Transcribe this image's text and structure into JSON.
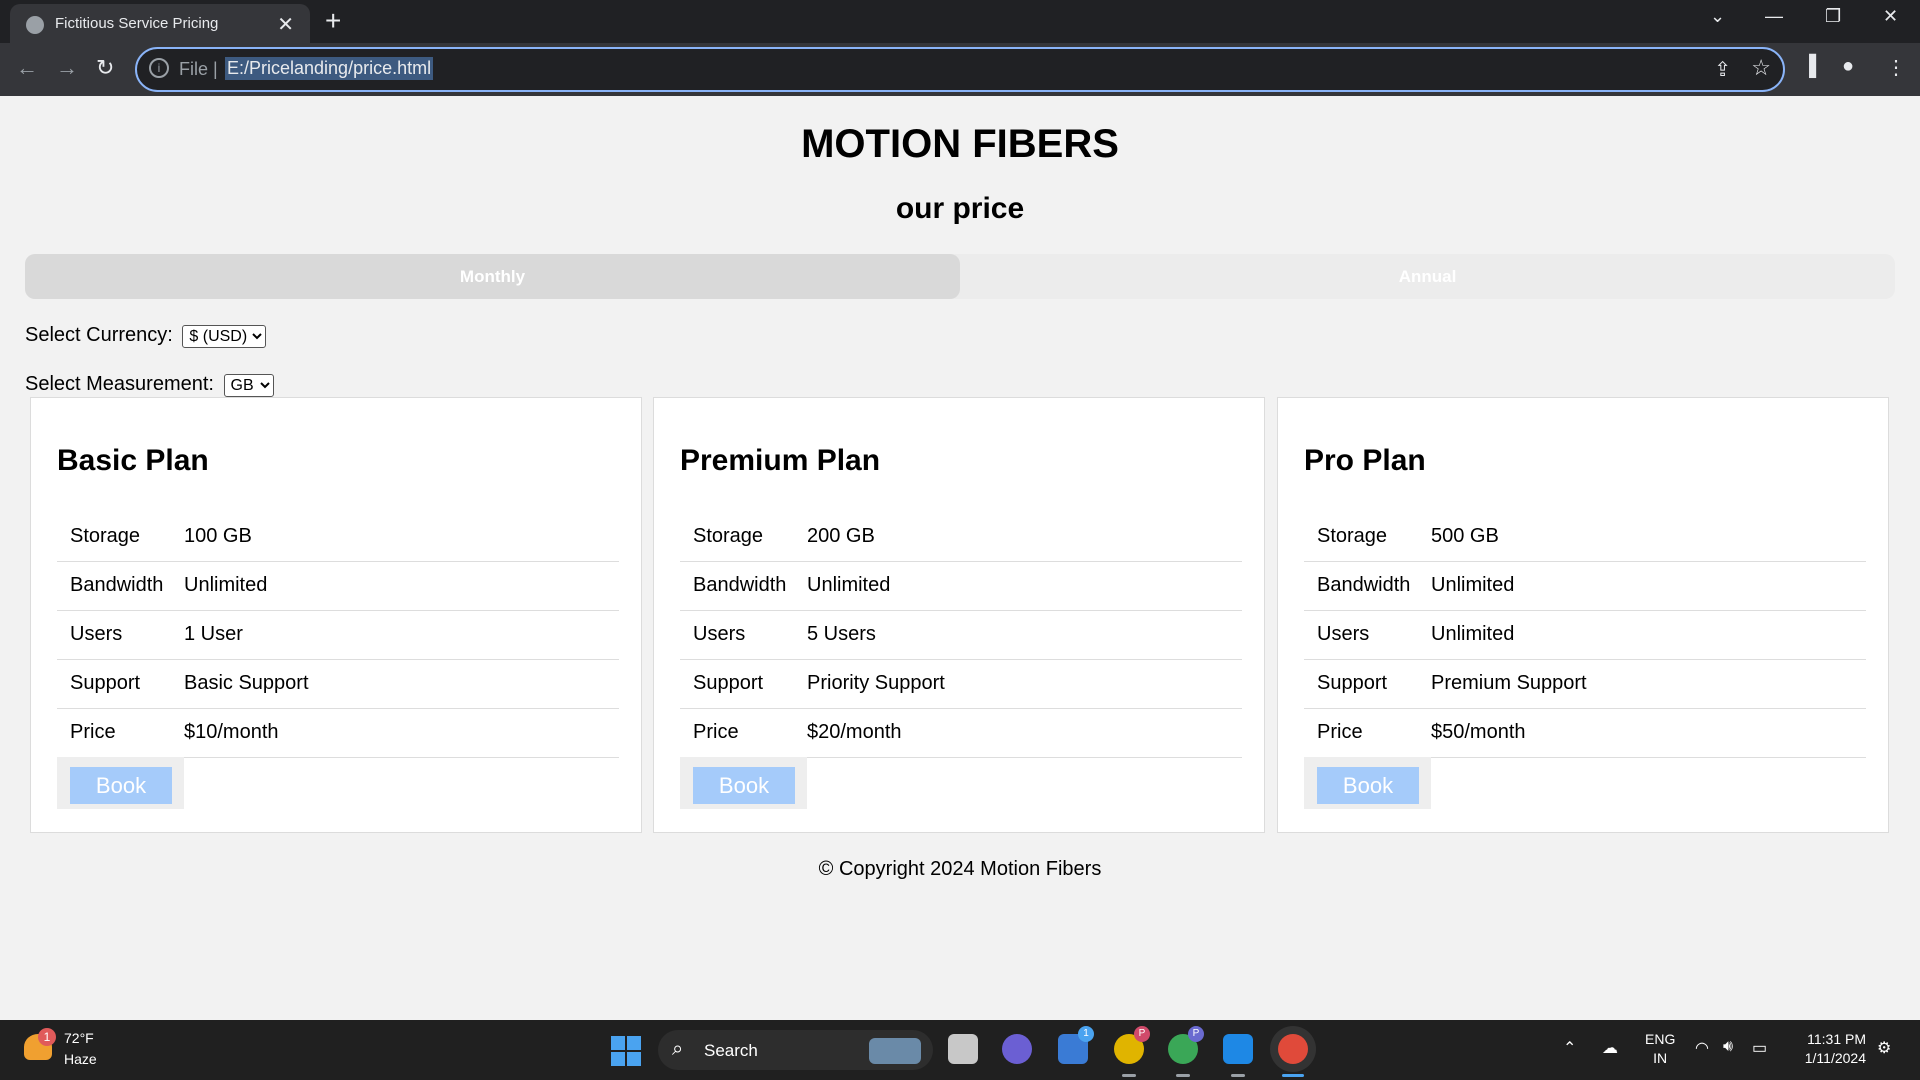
{
  "browser": {
    "tab_title": "Fictitious Service Pricing",
    "tab_close": "✕",
    "new_tab": "+",
    "url_scheme": "File",
    "url_separator": "|",
    "url": "E:/Pricelanding/price.html"
  },
  "page": {
    "brand": "MOTION FIBERS",
    "subtitle": "our price",
    "billing_toggle": {
      "monthly_label": "Monthly",
      "annual_label": "Annual",
      "selected": "Monthly"
    },
    "currency": {
      "label": "Select Currency:",
      "selected": "$ (USD)"
    },
    "measurement": {
      "label": "Select Measurement:",
      "selected": "GB"
    },
    "plans": [
      {
        "name": "Basic Plan",
        "rows": [
          {
            "k": "Storage",
            "v": "100 GB"
          },
          {
            "k": "Bandwidth",
            "v": "Unlimited"
          },
          {
            "k": "Users",
            "v": "1 User"
          },
          {
            "k": "Support",
            "v": "Basic Support"
          },
          {
            "k": "Price",
            "v": "$10/month"
          }
        ],
        "button": "Book"
      },
      {
        "name": "Premium Plan",
        "rows": [
          {
            "k": "Storage",
            "v": "200 GB"
          },
          {
            "k": "Bandwidth",
            "v": "Unlimited"
          },
          {
            "k": "Users",
            "v": "5 Users"
          },
          {
            "k": "Support",
            "v": "Priority Support"
          },
          {
            "k": "Price",
            "v": "$20/month"
          }
        ],
        "button": "Book"
      },
      {
        "name": "Pro Plan",
        "rows": [
          {
            "k": "Storage",
            "v": "500 GB"
          },
          {
            "k": "Bandwidth",
            "v": "Unlimited"
          },
          {
            "k": "Users",
            "v": "Unlimited"
          },
          {
            "k": "Support",
            "v": "Premium Support"
          },
          {
            "k": "Price",
            "v": "$50/month"
          }
        ],
        "button": "Book"
      }
    ],
    "footer": "© Copyright 2024 Motion Fibers"
  },
  "taskbar": {
    "weather": {
      "temp": "72°F",
      "condition": "Haze",
      "badge": "1"
    },
    "search_label": "Search",
    "store_badge": "1",
    "chrome_profile_badge_1": "P",
    "chrome_profile_badge_2": "P",
    "language": {
      "line1": "ENG",
      "line2": "IN"
    },
    "clock": {
      "time": "11:31 PM",
      "date": "1/11/2024"
    }
  },
  "colors": {
    "book_button": "#a5cbfa",
    "monthly_active": "#d9d9d9",
    "omnibox_focus": "#8ab4f8"
  }
}
